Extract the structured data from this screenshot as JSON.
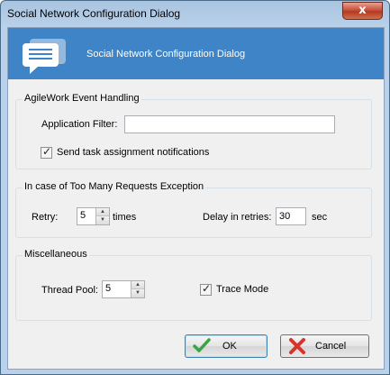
{
  "window": {
    "title": "Social Network Configuration Dialog",
    "close_glyph": "x"
  },
  "header": {
    "title": "Social Network Configuration Dialog",
    "icon": "chat-bubble-icon"
  },
  "event_handling": {
    "group_title": "AgileWork Event Handling",
    "filter_label": "Application Filter:",
    "filter_value": "",
    "send_notifications_label": "Send task assignment notifications",
    "send_notifications_checked": true
  },
  "too_many_requests": {
    "group_title": "In case of Too Many Requests Exception",
    "retry_label": "Retry:",
    "retry_value": "5",
    "retry_unit": "times",
    "delay_label": "Delay in retries:",
    "delay_value": "30",
    "delay_unit": "sec"
  },
  "misc": {
    "group_title": "Miscellaneous",
    "thread_pool_label": "Thread Pool:",
    "thread_pool_value": "5",
    "trace_mode_label": "Trace Mode",
    "trace_mode_checked": true
  },
  "buttons": {
    "ok_label": "OK",
    "cancel_label": "Cancel"
  },
  "glyphs": {
    "check": "✓",
    "up": "▲",
    "down": "▼"
  }
}
